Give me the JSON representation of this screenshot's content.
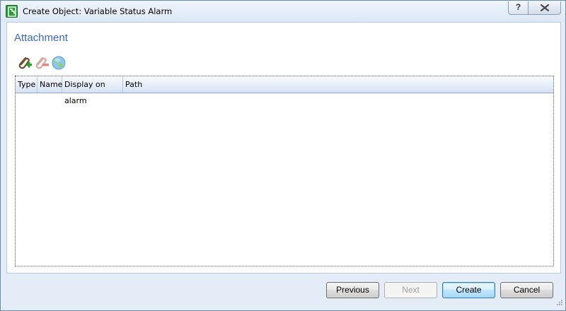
{
  "window": {
    "title": "Create Object: Variable Status Alarm",
    "help_label": "?",
    "icons": {
      "app": "app-icon",
      "close": "close-icon"
    }
  },
  "section": {
    "title": "Attachment"
  },
  "toolbar": {
    "buttons": [
      {
        "name": "add-attachment",
        "icon": "paperclip-add-icon"
      },
      {
        "name": "remove-attachment",
        "icon": "paperclip-remove-icon"
      },
      {
        "name": "web-attachment",
        "icon": "globe-icon"
      }
    ]
  },
  "table": {
    "columns": [
      "Type",
      "Name",
      "Display on alarm",
      "Path"
    ],
    "rows": []
  },
  "footer": {
    "previous_label": "Previous",
    "next_label": "Next",
    "create_label": "Create",
    "cancel_label": "Cancel"
  },
  "colors": {
    "accent": "#3d66c8",
    "window_frame": "#e3ecf7",
    "default_button": "#3c7fb1"
  }
}
